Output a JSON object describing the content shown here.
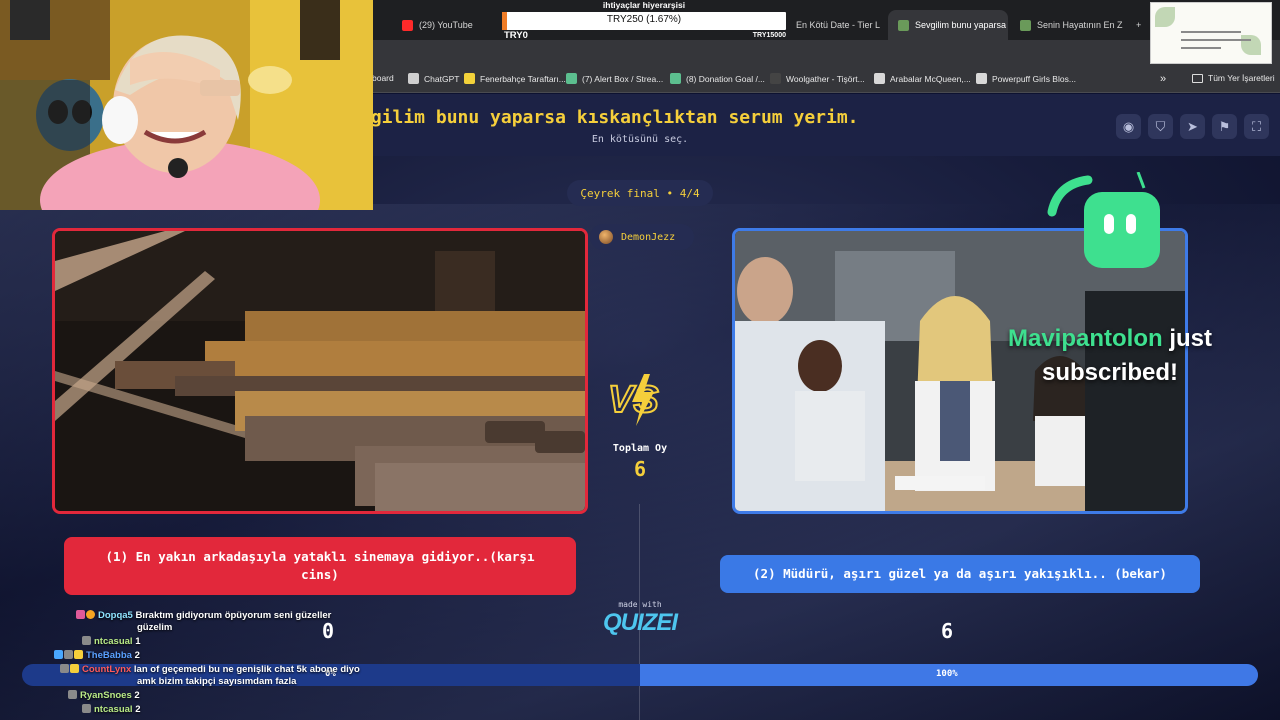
{
  "browser": {
    "tabs": [
      {
        "label": "(29) YouTube",
        "color": "#ff2a2a"
      },
      {
        "label": "En Kötü Date - Tier L",
        "color": "#8a8a8a"
      },
      {
        "label": "Sevgilim bunu yaparsa",
        "color": "#6a9a5a"
      },
      {
        "label": "Senin Hayatının En Z",
        "color": "#6a9a5a"
      }
    ],
    "new_tab_glyph": "+",
    "bookmarks": [
      {
        "label": "board"
      },
      {
        "label": "ChatGPT"
      },
      {
        "label": "Fenerbahçe Taraftarı..."
      },
      {
        "label": "(7) Alert Box / Strea..."
      },
      {
        "label": "(8) Donation Goal /..."
      },
      {
        "label": "Woolgather - Tişört..."
      },
      {
        "label": "Arabalar McQueen,..."
      },
      {
        "label": "Powerpuff Girls Blos..."
      }
    ],
    "more_glyph": "»",
    "all_bookmarks_label": "Tüm Yer İşaretleri"
  },
  "donation": {
    "title": "ihtiyaçlar hiyerarşisi",
    "bar_text": "TRY250 (1.67%)",
    "progress_fraction": 0.0167,
    "min_label": "TRY0",
    "max_label": "TRY15000",
    "fill_color": "#f07d27"
  },
  "quiz": {
    "title": "vgilim bunu yaparsa kıskançlıktan serum yerim.",
    "subtitle": "En kötüsünü seç.",
    "round": "Çeyrek final • 4/4",
    "author": "DemonJezz",
    "total_label": "Toplam Oy",
    "total_value": "6",
    "option1_text": "(1) En yakın arkadaşıyla yataklı sinemaya gidiyor..(karşı cins)",
    "option2_text": "(2) Müdürü, aşırı güzel ya da aşırı yakışıklı.. (bekar)",
    "score1": "0",
    "score2": "6",
    "pct1": "0%",
    "pct2": "100%",
    "pct1_fraction": 0,
    "pct2_fraction": 1,
    "made_with": "made with",
    "logo": "QUIZEI",
    "tools": [
      "eye-icon",
      "shield-icon",
      "send-icon",
      "flag-icon",
      "fullscreen-icon"
    ],
    "accent": "#f5cf3b",
    "option1_color": "#e2283b",
    "option2_color": "#3a79e6"
  },
  "alert": {
    "username": "Mavipantolon",
    "message": "just subscribed!"
  },
  "chat": [
    {
      "user": "Dopqa5",
      "color": "#8fe3ff",
      "text": "Bıraktım gidiyorum öpüyorum seni güzeller"
    },
    {
      "user": "",
      "color": "#ffffff",
      "text": "güzelim"
    },
    {
      "user": "ntcasual",
      "color": "#b8e986",
      "text": "1"
    },
    {
      "user": "TheBabba",
      "color": "#5aa0ff",
      "text": "2"
    },
    {
      "user": "CountLynx",
      "color": "#ff5a5a",
      "text": "lan of geçemedi bu ne genişlik chat 5k abone diyo"
    },
    {
      "user": "",
      "color": "#ffffff",
      "text": "amk bizim takipçi sayısımdam fazla"
    },
    {
      "user": "RyanSnoes",
      "color": "#b8e986",
      "text": "2"
    },
    {
      "user": "ntcasual",
      "color": "#b8e986",
      "text": "2"
    }
  ]
}
